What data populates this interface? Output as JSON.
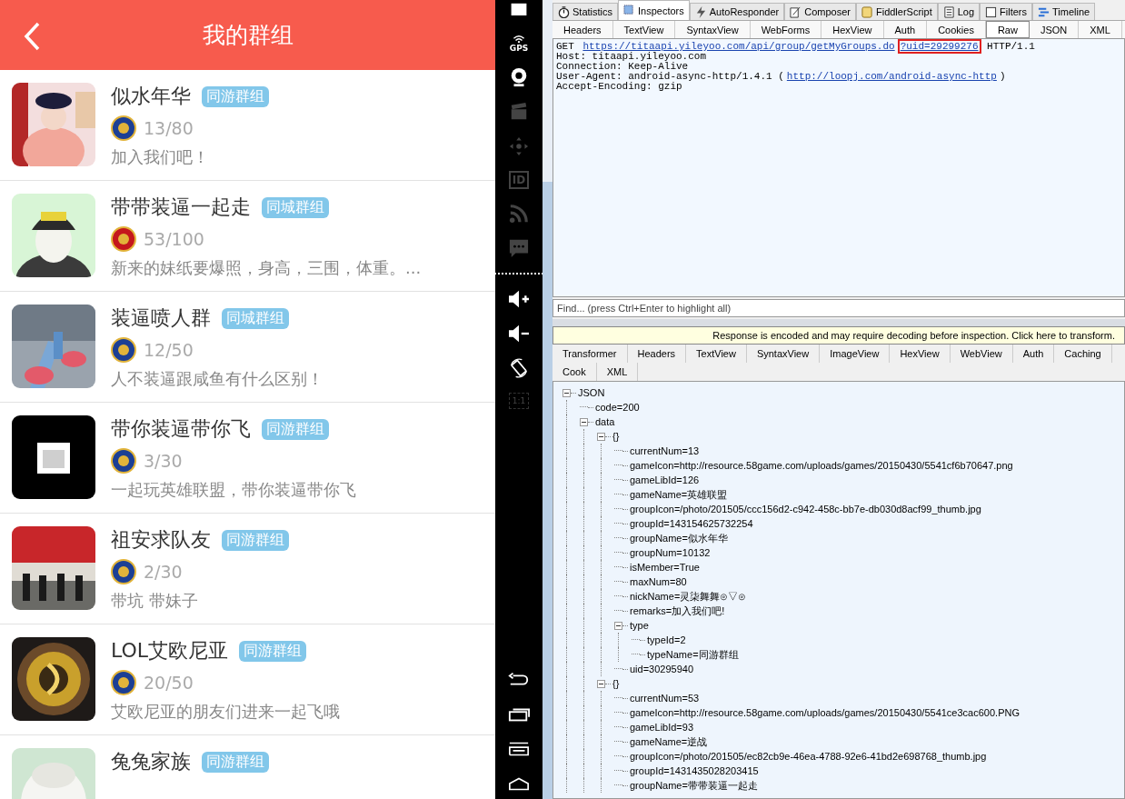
{
  "phone": {
    "title": "我的群组",
    "groups": [
      {
        "name": "似水年华",
        "tag": "同游群组",
        "game": {
          "color": "#1c3f94"
        },
        "count": "13/80",
        "remark": "加入我们吧！"
      },
      {
        "name": "带带装逼一起走",
        "tag": "同城群组",
        "game": {
          "color": "#c4171d"
        },
        "count": "53/100",
        "remark": "新来的妹纸要爆照，身高，三围，体重。..."
      },
      {
        "name": "装逼喷人群",
        "tag": "同城群组",
        "game": {
          "color": "#1c3f94"
        },
        "count": "12/50",
        "remark": "人不装逼跟咸鱼有什么区别！"
      },
      {
        "name": "带你装逼带你飞",
        "tag": "同游群组",
        "game": {
          "color": "#1c3f94"
        },
        "count": "3/30",
        "remark": "一起玩英雄联盟，带你装逼带你飞"
      },
      {
        "name": "祖安求队友",
        "tag": "同游群组",
        "game": {
          "color": "#1c3f94"
        },
        "count": "2/30",
        "remark": "带坑 带妹子"
      },
      {
        "name": "LOL艾欧尼亚",
        "tag": "同游群组",
        "game": {
          "color": "#1c3f94"
        },
        "count": "20/50",
        "remark": "艾欧尼亚的朋友们进来一起飞哦"
      },
      {
        "name": "兔兔家族",
        "tag": "同游群组"
      }
    ]
  },
  "emulator": {
    "gps_label": "GPS",
    "id_label": "ID",
    "scale_label": "1:1"
  },
  "fiddler": {
    "tabs": [
      {
        "label": "Statistics",
        "selected": false
      },
      {
        "label": "Inspectors",
        "selected": true
      },
      {
        "label": "AutoResponder",
        "selected": false
      },
      {
        "label": "Composer",
        "selected": false
      },
      {
        "label": "FiddlerScript",
        "selected": false
      },
      {
        "label": "Log",
        "selected": false
      },
      {
        "label": "Filters",
        "selected": false
      },
      {
        "label": "Timeline",
        "selected": false
      }
    ],
    "request_tabs": [
      {
        "label": "Headers",
        "selected": false
      },
      {
        "label": "TextView",
        "selected": false
      },
      {
        "label": "SyntaxView",
        "selected": false
      },
      {
        "label": "WebForms",
        "selected": false
      },
      {
        "label": "HexView",
        "selected": false
      },
      {
        "label": "Auth",
        "selected": false
      },
      {
        "label": "Cookies",
        "selected": false
      },
      {
        "label": "Raw",
        "selected": true
      },
      {
        "label": "JSON",
        "selected": false
      },
      {
        "label": "XML",
        "selected": false
      }
    ],
    "request_lines": [
      {
        "parts": [
          {
            "text": "GET "
          },
          {
            "text": "https://titaapi.yileyoo.com/api/group/getMyGroups.do",
            "link": true,
            "highlight": false
          },
          {
            "text": "?uid=29299276",
            "link": true,
            "highlight": true
          },
          {
            "text": " HTTP/1.1"
          }
        ]
      },
      {
        "parts": [
          {
            "text": "Host: titaapi.yileyoo.com"
          }
        ]
      },
      {
        "parts": [
          {
            "text": "Connection: Keep-Alive"
          }
        ]
      },
      {
        "parts": [
          {
            "text": "User-Agent: android-async-http/1.4.1 ("
          },
          {
            "text": "http://loopj.com/android-async-http",
            "link": true,
            "highlight": false
          },
          {
            "text": ")"
          }
        ]
      },
      {
        "parts": [
          {
            "text": "Accept-Encoding: gzip"
          }
        ]
      }
    ],
    "find": {
      "placeholder": "Find... (press Ctrl+Enter to highlight all)"
    },
    "notice": "Response is encoded and may require decoding before inspection. Click here to transform.",
    "response_tabs": [
      "Transformer",
      "Headers",
      "TextView",
      "SyntaxView",
      "ImageView",
      "HexView",
      "WebView",
      "Auth",
      "Caching",
      "Cook",
      "XML"
    ],
    "tree": [
      {
        "label": "JSON",
        "expanded": true,
        "children": [
          {
            "label": "code=200"
          },
          {
            "label": "data",
            "expanded": true,
            "children": [
              {
                "label": "{}",
                "expanded": true,
                "children": [
                  {
                    "label": "currentNum=13"
                  },
                  {
                    "label": "gameIcon=http://resource.58game.com/uploads/games/20150430/5541cf6b70647.png"
                  },
                  {
                    "label": "gameLibId=126"
                  },
                  {
                    "label": "gameName=英雄联盟"
                  },
                  {
                    "label": "groupIcon=/photo/201505/ccc156d2-c942-458c-bb7e-db030d8acf99_thumb.jpg"
                  },
                  {
                    "label": "groupId=143154625732254"
                  },
                  {
                    "label": "groupName=似水年华"
                  },
                  {
                    "label": "groupNum=10132"
                  },
                  {
                    "label": "isMember=True"
                  },
                  {
                    "label": "maxNum=80"
                  },
                  {
                    "label": "nickName=灵柒舞舞⊙▽⊙"
                  },
                  {
                    "label": "remarks=加入我们吧!"
                  },
                  {
                    "label": "type",
                    "expanded": true,
                    "children": [
                      {
                        "label": "typeId=2"
                      },
                      {
                        "label": "typeName=同游群组"
                      }
                    ]
                  },
                  {
                    "label": "uid=30295940"
                  }
                ]
              },
              {
                "label": "{}",
                "expanded": true,
                "children": [
                  {
                    "label": "currentNum=53"
                  },
                  {
                    "label": "gameIcon=http://resource.58game.com/uploads/games/20150430/5541ce3cac600.PNG"
                  },
                  {
                    "label": "gameLibId=93"
                  },
                  {
                    "label": "gameName=逆战"
                  },
                  {
                    "label": "groupIcon=/photo/201505/ec82cb9e-46ea-4788-92e6-41bd2e698768_thumb.jpg"
                  },
                  {
                    "label": "groupId=1431435028203415"
                  },
                  {
                    "label": "groupName=带带装逼一起走"
                  }
                ]
              }
            ]
          }
        ]
      }
    ]
  }
}
